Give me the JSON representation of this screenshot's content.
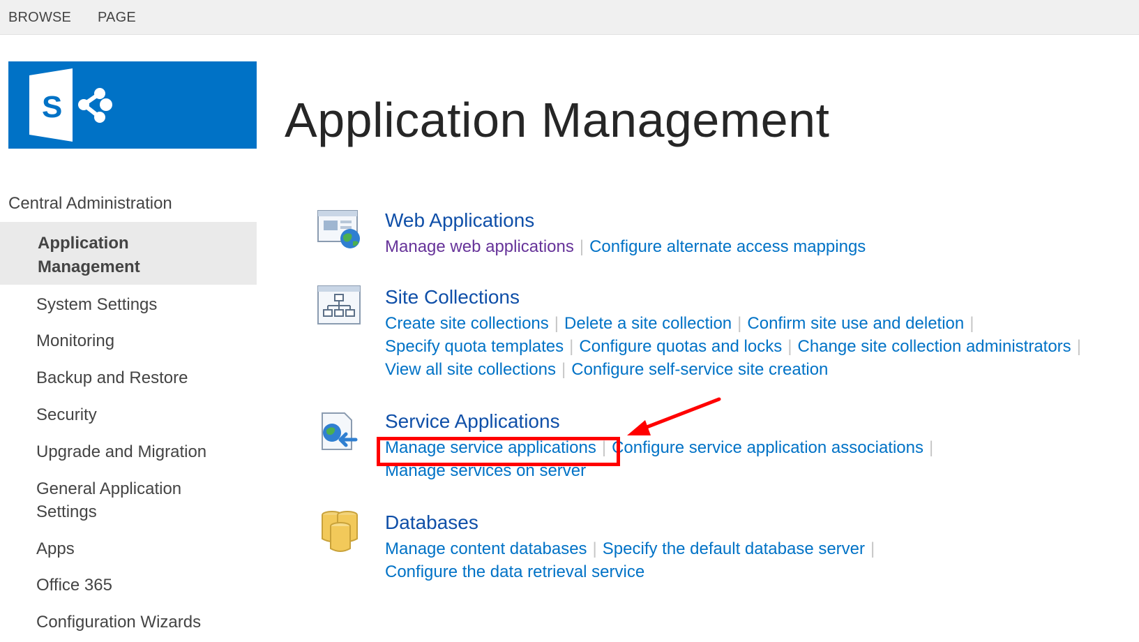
{
  "ribbon": {
    "browse": "BROWSE",
    "page": "PAGE"
  },
  "page_title": "Application Management",
  "nav": {
    "header": "Central Administration",
    "selected": "Application Management",
    "items": [
      "System Settings",
      "Monitoring",
      "Backup and Restore",
      "Security",
      "Upgrade and Migration",
      "General Application Settings",
      "Apps",
      "Office 365",
      "Configuration Wizards"
    ]
  },
  "sections": {
    "web_apps": {
      "title": "Web Applications",
      "links": [
        "Manage web applications",
        "Configure alternate access mappings"
      ]
    },
    "site_collections": {
      "title": "Site Collections",
      "links": [
        "Create site collections",
        "Delete a site collection",
        "Confirm site use and deletion",
        "Specify quota templates",
        "Configure quotas and locks",
        "Change site collection administrators",
        "View all site collections",
        "Configure self-service site creation"
      ]
    },
    "service_apps": {
      "title": "Service Applications",
      "links": [
        "Manage service applications",
        "Configure service application associations",
        "Manage services on server"
      ]
    },
    "databases": {
      "title": "Databases",
      "links": [
        "Manage content databases",
        "Specify the default database server",
        "Configure the data retrieval service"
      ]
    }
  },
  "icons": {
    "logo": "sharepoint-logo-icon",
    "web_apps": "web-application-icon",
    "site_collections": "site-collection-icon",
    "service_apps": "service-application-icon",
    "databases": "database-icon"
  },
  "colors": {
    "brand": "#0072c6",
    "link": "#0072c6",
    "visited_link": "#663399",
    "highlight": "#ff0000",
    "nav_selected_bg": "#eaeaea"
  }
}
